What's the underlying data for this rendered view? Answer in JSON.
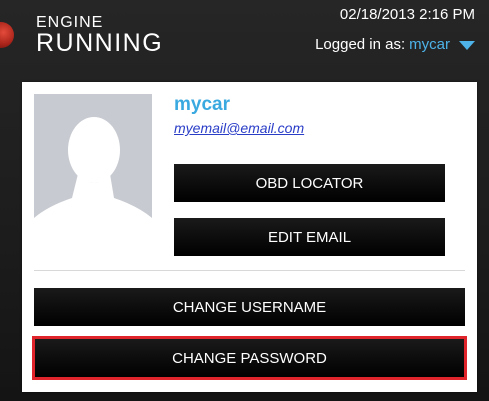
{
  "header": {
    "brand_top": "ENGINE",
    "brand_bottom": "RUNNING",
    "datetime": "02/18/2013 2:16 PM",
    "logged_in_prefix": "Logged in as:",
    "username": "mycar"
  },
  "profile": {
    "display_name": "mycar",
    "email": "myemail@email.com"
  },
  "buttons": {
    "obd_locator": "OBD LOCATOR",
    "edit_email": "EDIT EMAIL",
    "change_username": "CHANGE USERNAME",
    "change_password": "CHANGE PASSWORD"
  },
  "colors": {
    "accent_blue": "#4db3e8",
    "highlight_red": "#e0242b",
    "button_black": "#000000"
  },
  "icons": {
    "dropdown": "caret-down-icon",
    "avatar": "default-user-silhouette-icon"
  }
}
